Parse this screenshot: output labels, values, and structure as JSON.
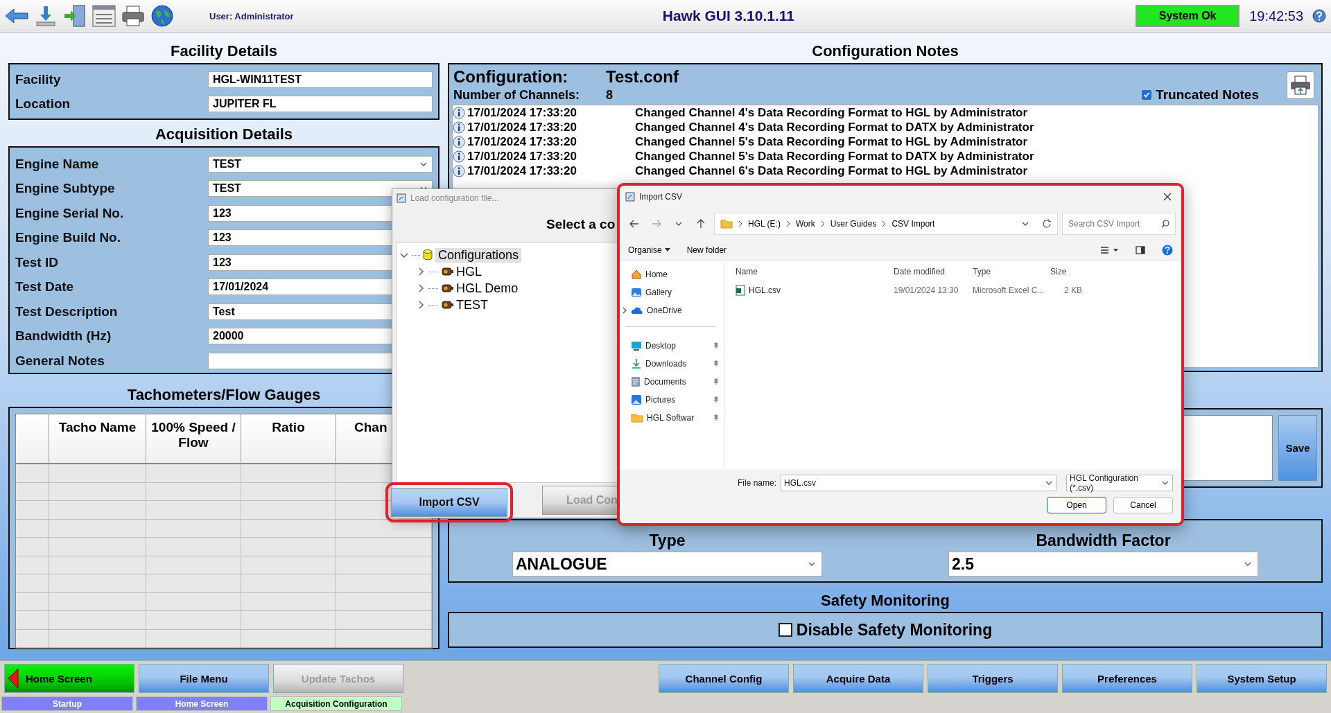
{
  "toolbar": {
    "user": "User: Administrator",
    "title": "Hawk GUI 3.10.1.11",
    "status": "System Ok",
    "time": "19:42:53"
  },
  "facility": {
    "title": "Facility Details",
    "fields": [
      {
        "label": "Facility",
        "value": "HGL-WIN11TEST"
      },
      {
        "label": "Location",
        "value": "JUPITER FL"
      }
    ]
  },
  "acquisition": {
    "title": "Acquisition Details",
    "fields": [
      {
        "label": "Engine Name",
        "value": "TEST",
        "kind": "dropdown"
      },
      {
        "label": "Engine Subtype",
        "value": "TEST",
        "kind": "dropdown"
      },
      {
        "label": "Engine Serial No.",
        "value": "123",
        "kind": "text"
      },
      {
        "label": "Engine Build No.",
        "value": "123",
        "kind": "text"
      },
      {
        "label": "Test ID",
        "value": "123",
        "kind": "text"
      },
      {
        "label": "Test Date",
        "value": "17/01/2024",
        "kind": "text"
      },
      {
        "label": "Test Description",
        "value": "Test",
        "kind": "text"
      },
      {
        "label": "Bandwidth (Hz)",
        "value": "20000",
        "kind": "text"
      },
      {
        "label": "General Notes",
        "kind": "text"
      }
    ]
  },
  "tachometers": {
    "title": "Tachometers/Flow Gauges",
    "columns": [
      "Tacho Name",
      "100% Speed / Flow",
      "Ratio",
      "Chan"
    ]
  },
  "configuration_notes": {
    "title": "Configuration Notes",
    "configuration_label": "Configuration:",
    "configuration_value": "Test.conf",
    "channels_label": "Number of Channels:",
    "channels_value": "8",
    "truncated_notes": {
      "label": "Truncated Notes",
      "checked": true
    },
    "notes": [
      {
        "time": "17/01/2024 17:33:20",
        "text": "Changed Channel 4's Data Recording Format to HGL by Administrator"
      },
      {
        "time": "17/01/2024 17:33:20",
        "text": "Changed Channel 4's Data Recording Format to DATX by Administrator"
      },
      {
        "time": "17/01/2024 17:33:20",
        "text": "Changed Channel 5's Data Recording Format to HGL by Administrator"
      },
      {
        "time": "17/01/2024 17:33:20",
        "text": "Changed Channel 5's Data Recording Format to DATX by Administrator"
      },
      {
        "time": "17/01/2024 17:33:20",
        "text": "Changed Channel 6's Data Recording Format to HGL by Administrator"
      }
    ]
  },
  "channel_panel": {
    "save": "Save",
    "type_label": "Type",
    "type_value": "ANALOGUE",
    "bandwidth_label": "Bandwidth Factor",
    "bandwidth_value": "2.5"
  },
  "safety": {
    "title": "Safety Monitoring",
    "disable": {
      "label": "Disable Safety Monitoring",
      "checked": false
    }
  },
  "nav": {
    "left": [
      {
        "label": "Home Screen",
        "kind": "home",
        "disabled": false
      },
      {
        "label": "File Menu",
        "kind": "normal",
        "disabled": false
      },
      {
        "label": "Update Tachos",
        "kind": "normal",
        "disabled": true
      }
    ],
    "right": [
      {
        "label": "Channel Config",
        "kind": "normal",
        "disabled": false
      },
      {
        "label": "Acquire Data",
        "kind": "normal",
        "disabled": false
      },
      {
        "label": "Triggers",
        "kind": "normal",
        "disabled": false
      },
      {
        "label": "Preferences",
        "kind": "normal",
        "disabled": false
      },
      {
        "label": "System Setup",
        "kind": "normal",
        "disabled": false
      }
    ]
  },
  "breadcrumbs": [
    {
      "label": "Startup",
      "selected": false
    },
    {
      "label": "Home Screen",
      "selected": false
    },
    {
      "label": "Acquisition Configuration",
      "selected": true
    }
  ],
  "load_dialog": {
    "title": "Load configuration file...",
    "heading": "Select a co",
    "tree": [
      {
        "label": "Configurations",
        "kind": "database",
        "expanded": true,
        "selected": true,
        "children": [
          {
            "label": "HGL",
            "kind": "engine",
            "expanded": false,
            "selected": false
          },
          {
            "label": "HGL Demo",
            "kind": "engine",
            "expanded": false,
            "selected": false
          },
          {
            "label": "TEST",
            "kind": "engine",
            "expanded": false,
            "selected": false
          }
        ]
      }
    ],
    "buttons": [
      {
        "label": "Import CSV",
        "disabled": false,
        "highlighted": true
      },
      {
        "label": "Load Con",
        "disabled": true,
        "highlighted": false
      }
    ]
  },
  "import_dialog": {
    "title": "Import CSV",
    "highlighted": true,
    "path": [
      "HGL (E:)",
      "Work",
      "User Guides",
      "CSV Import"
    ],
    "search_placeholder": "Search CSV Import",
    "commands": [
      "Organise",
      "New folder"
    ],
    "nav": [
      {
        "label": "Home",
        "kind": "home",
        "pinned": false,
        "expandable": false
      },
      {
        "label": "Gallery",
        "kind": "gallery",
        "pinned": false,
        "expandable": false
      },
      {
        "label": "OneDrive",
        "kind": "cloud",
        "pinned": false,
        "expandable": true
      },
      {
        "label": "Desktop",
        "kind": "desktop",
        "pinned": true,
        "expandable": false
      },
      {
        "label": "Downloads",
        "kind": "download",
        "pinned": true,
        "expandable": false
      },
      {
        "label": "Documents",
        "kind": "document",
        "pinned": true,
        "expandable": false
      },
      {
        "label": "Pictures",
        "kind": "pictures",
        "pinned": true,
        "expandable": false
      },
      {
        "label": "HGL Softwar",
        "kind": "folder",
        "pinned": true,
        "expandable": false
      }
    ],
    "columns": [
      "Name",
      "Date modified",
      "Type",
      "Size"
    ],
    "files": [
      {
        "name": "HGL.csv",
        "date": "19/01/2024 13:30",
        "type": "Microsoft Excel C...",
        "size": "2 KB"
      }
    ],
    "file_name_label": "File name:",
    "file_name": "HGL.csv",
    "filter": "HGL Configuration (*.csv)",
    "buttons": [
      {
        "label": "Open",
        "kind": "primary"
      },
      {
        "label": "Cancel",
        "kind": "secondary"
      }
    ]
  }
}
